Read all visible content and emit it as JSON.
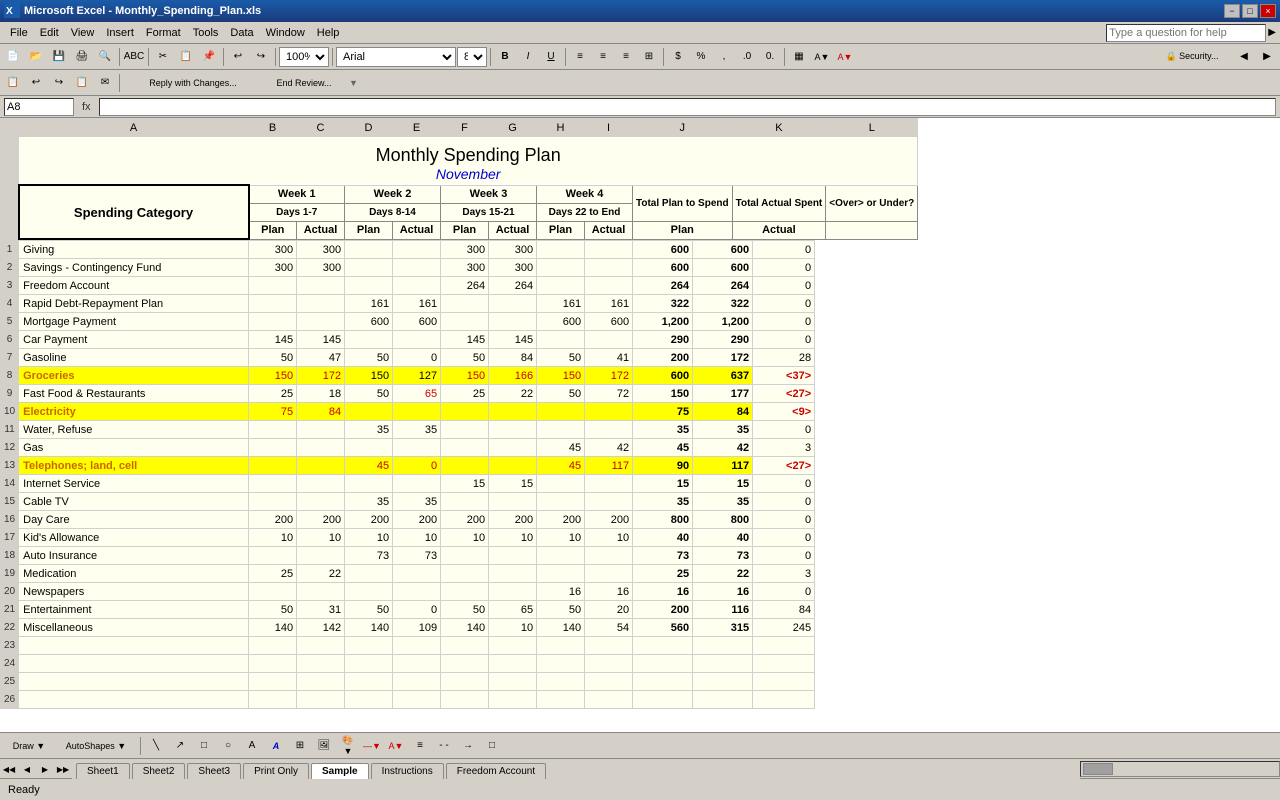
{
  "titleBar": {
    "icon": "excel-icon",
    "title": "Microsoft Excel - Monthly_Spending_Plan.xls",
    "minimize": "−",
    "maximize": "□",
    "close": "×"
  },
  "menuBar": {
    "items": [
      "File",
      "Edit",
      "View",
      "Insert",
      "Format",
      "Tools",
      "Data",
      "Window",
      "Help"
    ]
  },
  "toolbar": {
    "zoom": "100%",
    "font": "Arial",
    "size": "8"
  },
  "formulaBar": {
    "nameBox": "A8",
    "fx": "fx"
  },
  "toolbar2": {
    "replyLabel": "Reply with Changes...",
    "endReview": "End Review..."
  },
  "helpBar": {
    "placeholder": "Type a question for help"
  },
  "spreadsheet": {
    "title": "Monthly Spending Plan",
    "subtitle": "November",
    "columnHeaders": [
      "A",
      "B",
      "C",
      "D",
      "E",
      "F",
      "G",
      "H",
      "I",
      "J",
      "K",
      "L"
    ],
    "headers": {
      "spendingCategory": "Spending Category",
      "week1Label": "Week 1",
      "week1Days": "Days 1-7",
      "week2Label": "Week 2",
      "week2Days": "Days 8-14",
      "week3Label": "Week 3",
      "week3Days": "Days 15-21",
      "week4Label": "Week 4",
      "week4Days": "Days 22 to End",
      "totalPlanLabel": "Total Plan to Spend",
      "totalActualLabel": "Total Actual Spent",
      "overLabel": "<Over> or Under?",
      "plan": "Plan",
      "actual": "Actual"
    },
    "rows": [
      {
        "num": 1,
        "category": "Giving",
        "w1p": "300",
        "w1a": "300",
        "w2p": "",
        "w2a": "",
        "w3p": "300",
        "w3a": "300",
        "w4p": "",
        "w4a": "",
        "tp": "600",
        "ta": "600",
        "ou": "0",
        "bg": "white",
        "ouClass": "over-pos"
      },
      {
        "num": 2,
        "category": "Savings - Contingency Fund",
        "w1p": "300",
        "w1a": "300",
        "w2p": "",
        "w2a": "",
        "w3p": "300",
        "w3a": "300",
        "w4p": "",
        "w4a": "",
        "tp": "600",
        "ta": "600",
        "ou": "0",
        "bg": "white",
        "ouClass": "over-pos"
      },
      {
        "num": 3,
        "category": "Freedom Account",
        "w1p": "",
        "w1a": "",
        "w2p": "",
        "w2a": "",
        "w3p": "264",
        "w3a": "264",
        "w4p": "",
        "w4a": "",
        "tp": "264",
        "ta": "264",
        "ou": "0",
        "bg": "white",
        "ouClass": "over-pos"
      },
      {
        "num": 4,
        "category": "Rapid Debt-Repayment Plan",
        "w1p": "",
        "w1a": "",
        "w2p": "161",
        "w2a": "161",
        "w3p": "",
        "w3a": "",
        "w4p": "161",
        "w4a": "161",
        "tp": "322",
        "ta": "322",
        "ou": "0",
        "bg": "white",
        "ouClass": "over-pos"
      },
      {
        "num": 5,
        "category": "Mortgage Payment",
        "w1p": "",
        "w1a": "",
        "w2p": "600",
        "w2a": "600",
        "w3p": "",
        "w3a": "",
        "w4p": "600",
        "w4a": "600",
        "tp": "1,200",
        "ta": "1,200",
        "ou": "0",
        "bg": "white",
        "ouClass": "over-pos"
      },
      {
        "num": 6,
        "category": "Car Payment",
        "w1p": "145",
        "w1a": "145",
        "w2p": "",
        "w2a": "",
        "w3p": "145",
        "w3a": "145",
        "w4p": "",
        "w4a": "",
        "tp": "290",
        "ta": "290",
        "ou": "0",
        "bg": "white",
        "ouClass": "over-pos"
      },
      {
        "num": 7,
        "category": "Gasoline",
        "w1p": "50",
        "w1a": "47",
        "w2p": "50",
        "w2a": "0",
        "w3p": "50",
        "w3a": "84",
        "w4p": "50",
        "w4a": "41",
        "tp": "200",
        "ta": "172",
        "ou": "28",
        "bg": "white",
        "ouClass": "over-pos"
      },
      {
        "num": 8,
        "category": "Groceries",
        "w1p": "150",
        "w1a": "172",
        "w2p": "150",
        "w2a": "127",
        "w3p": "150",
        "w3a": "166",
        "w4p": "150",
        "w4a": "172",
        "tp": "600",
        "ta": "637",
        "ou": "<37>",
        "bg": "yellow",
        "ouClass": "over-neg"
      },
      {
        "num": 9,
        "category": "Fast Food & Restaurants",
        "w1p": "25",
        "w1a": "18",
        "w2p": "50",
        "w2a": "65",
        "w3p": "25",
        "w3a": "22",
        "w4p": "50",
        "w4a": "72",
        "tp": "150",
        "ta": "177",
        "ou": "<27>",
        "bg": "white",
        "ouClass": "over-neg"
      },
      {
        "num": 10,
        "category": "Electricity",
        "w1p": "75",
        "w1a": "84",
        "w2p": "",
        "w2a": "",
        "w3p": "",
        "w3a": "",
        "w4p": "",
        "w4a": "",
        "tp": "75",
        "ta": "84",
        "ou": "<9>",
        "bg": "yellow",
        "ouClass": "over-neg"
      },
      {
        "num": 11,
        "category": "Water, Refuse",
        "w1p": "",
        "w1a": "",
        "w2p": "35",
        "w2a": "35",
        "w3p": "",
        "w3a": "",
        "w4p": "",
        "w4a": "",
        "tp": "35",
        "ta": "35",
        "ou": "0",
        "bg": "white",
        "ouClass": "over-pos"
      },
      {
        "num": 12,
        "category": "Gas",
        "w1p": "",
        "w1a": "",
        "w2p": "",
        "w2a": "",
        "w3p": "",
        "w3a": "",
        "w4p": "45",
        "w4a": "42",
        "tp": "45",
        "ta": "42",
        "ou": "3",
        "bg": "white",
        "ouClass": "over-pos"
      },
      {
        "num": 13,
        "category": "Telephones; land, cell",
        "w1p": "",
        "w1a": "",
        "w2p": "45",
        "w2a": "0",
        "w3p": "",
        "w3a": "",
        "w4p": "45",
        "w4a": "117",
        "tp": "90",
        "ta": "117",
        "ou": "<27>",
        "bg": "yellow",
        "ouClass": "over-neg"
      },
      {
        "num": 14,
        "category": "Internet Service",
        "w1p": "",
        "w1a": "",
        "w2p": "",
        "w2a": "",
        "w3p": "15",
        "w3a": "15",
        "w4p": "",
        "w4a": "",
        "tp": "15",
        "ta": "15",
        "ou": "0",
        "bg": "white",
        "ouClass": "over-pos"
      },
      {
        "num": 15,
        "category": "Cable TV",
        "w1p": "",
        "w1a": "",
        "w2p": "35",
        "w2a": "35",
        "w3p": "",
        "w3a": "",
        "w4p": "",
        "w4a": "",
        "tp": "35",
        "ta": "35",
        "ou": "0",
        "bg": "white",
        "ouClass": "over-pos"
      },
      {
        "num": 16,
        "category": "Day Care",
        "w1p": "200",
        "w1a": "200",
        "w2p": "200",
        "w2a": "200",
        "w3p": "200",
        "w3a": "200",
        "w4p": "200",
        "w4a": "200",
        "tp": "800",
        "ta": "800",
        "ou": "0",
        "bg": "white",
        "ouClass": "over-pos"
      },
      {
        "num": 17,
        "category": "Kid's Allowance",
        "w1p": "10",
        "w1a": "10",
        "w2p": "10",
        "w2a": "10",
        "w3p": "10",
        "w3a": "10",
        "w4p": "10",
        "w4a": "10",
        "tp": "40",
        "ta": "40",
        "ou": "0",
        "bg": "white",
        "ouClass": "over-pos"
      },
      {
        "num": 18,
        "category": "Auto Insurance",
        "w1p": "",
        "w1a": "",
        "w2p": "73",
        "w2a": "73",
        "w3p": "",
        "w3a": "",
        "w4p": "",
        "w4a": "",
        "tp": "73",
        "ta": "73",
        "ou": "0",
        "bg": "white",
        "ouClass": "over-pos"
      },
      {
        "num": 19,
        "category": "Medication",
        "w1p": "25",
        "w1a": "22",
        "w2p": "",
        "w2a": "",
        "w3p": "",
        "w3a": "",
        "w4p": "",
        "w4a": "",
        "tp": "25",
        "ta": "22",
        "ou": "3",
        "bg": "white",
        "ouClass": "over-pos"
      },
      {
        "num": 20,
        "category": "Newspapers",
        "w1p": "",
        "w1a": "",
        "w2p": "",
        "w2a": "",
        "w3p": "",
        "w3a": "",
        "w4p": "16",
        "w4a": "16",
        "tp": "16",
        "ta": "16",
        "ou": "0",
        "bg": "white",
        "ouClass": "over-pos"
      },
      {
        "num": 21,
        "category": "Entertainment",
        "w1p": "50",
        "w1a": "31",
        "w2p": "50",
        "w2a": "0",
        "w3p": "50",
        "w3a": "65",
        "w4p": "50",
        "w4a": "20",
        "tp": "200",
        "ta": "116",
        "ou": "84",
        "bg": "white",
        "ouClass": "over-pos"
      },
      {
        "num": 22,
        "category": "Miscellaneous",
        "w1p": "140",
        "w1a": "142",
        "w2p": "140",
        "w2a": "109",
        "w3p": "140",
        "w3a": "10",
        "w4p": "140",
        "w4a": "54",
        "tp": "560",
        "ta": "315",
        "ou": "245",
        "bg": "white",
        "ouClass": "over-pos"
      },
      {
        "num": 23,
        "category": "",
        "w1p": "",
        "w1a": "",
        "w2p": "",
        "w2a": "",
        "w3p": "",
        "w3a": "",
        "w4p": "",
        "w4a": "",
        "tp": "",
        "ta": "",
        "ou": "",
        "bg": "white",
        "ouClass": "over-pos"
      },
      {
        "num": 24,
        "category": "",
        "w1p": "",
        "w1a": "",
        "w2p": "",
        "w2a": "",
        "w3p": "",
        "w3a": "",
        "w4p": "",
        "w4a": "",
        "tp": "",
        "ta": "",
        "ou": "",
        "bg": "white",
        "ouClass": "over-pos"
      },
      {
        "num": 25,
        "category": "",
        "w1p": "",
        "w1a": "",
        "w2p": "",
        "w2a": "",
        "w3p": "",
        "w3a": "",
        "w4p": "",
        "w4a": "",
        "tp": "",
        "ta": "",
        "ou": "",
        "bg": "white",
        "ouClass": "over-pos"
      },
      {
        "num": 26,
        "category": "",
        "w1p": "",
        "w1a": "",
        "w2p": "",
        "w2a": "",
        "w3p": "",
        "w3a": "",
        "w4p": "",
        "w4a": "",
        "tp": "",
        "ta": "",
        "ou": "",
        "bg": "white",
        "ouClass": "over-pos"
      }
    ]
  },
  "sheetTabs": [
    "Sheet1",
    "Sheet2",
    "Sheet3",
    "Print Only",
    "Sample",
    "Instructions",
    "Freedom Account"
  ],
  "activeSheet": "Sample",
  "statusBar": {
    "status": "Ready"
  }
}
